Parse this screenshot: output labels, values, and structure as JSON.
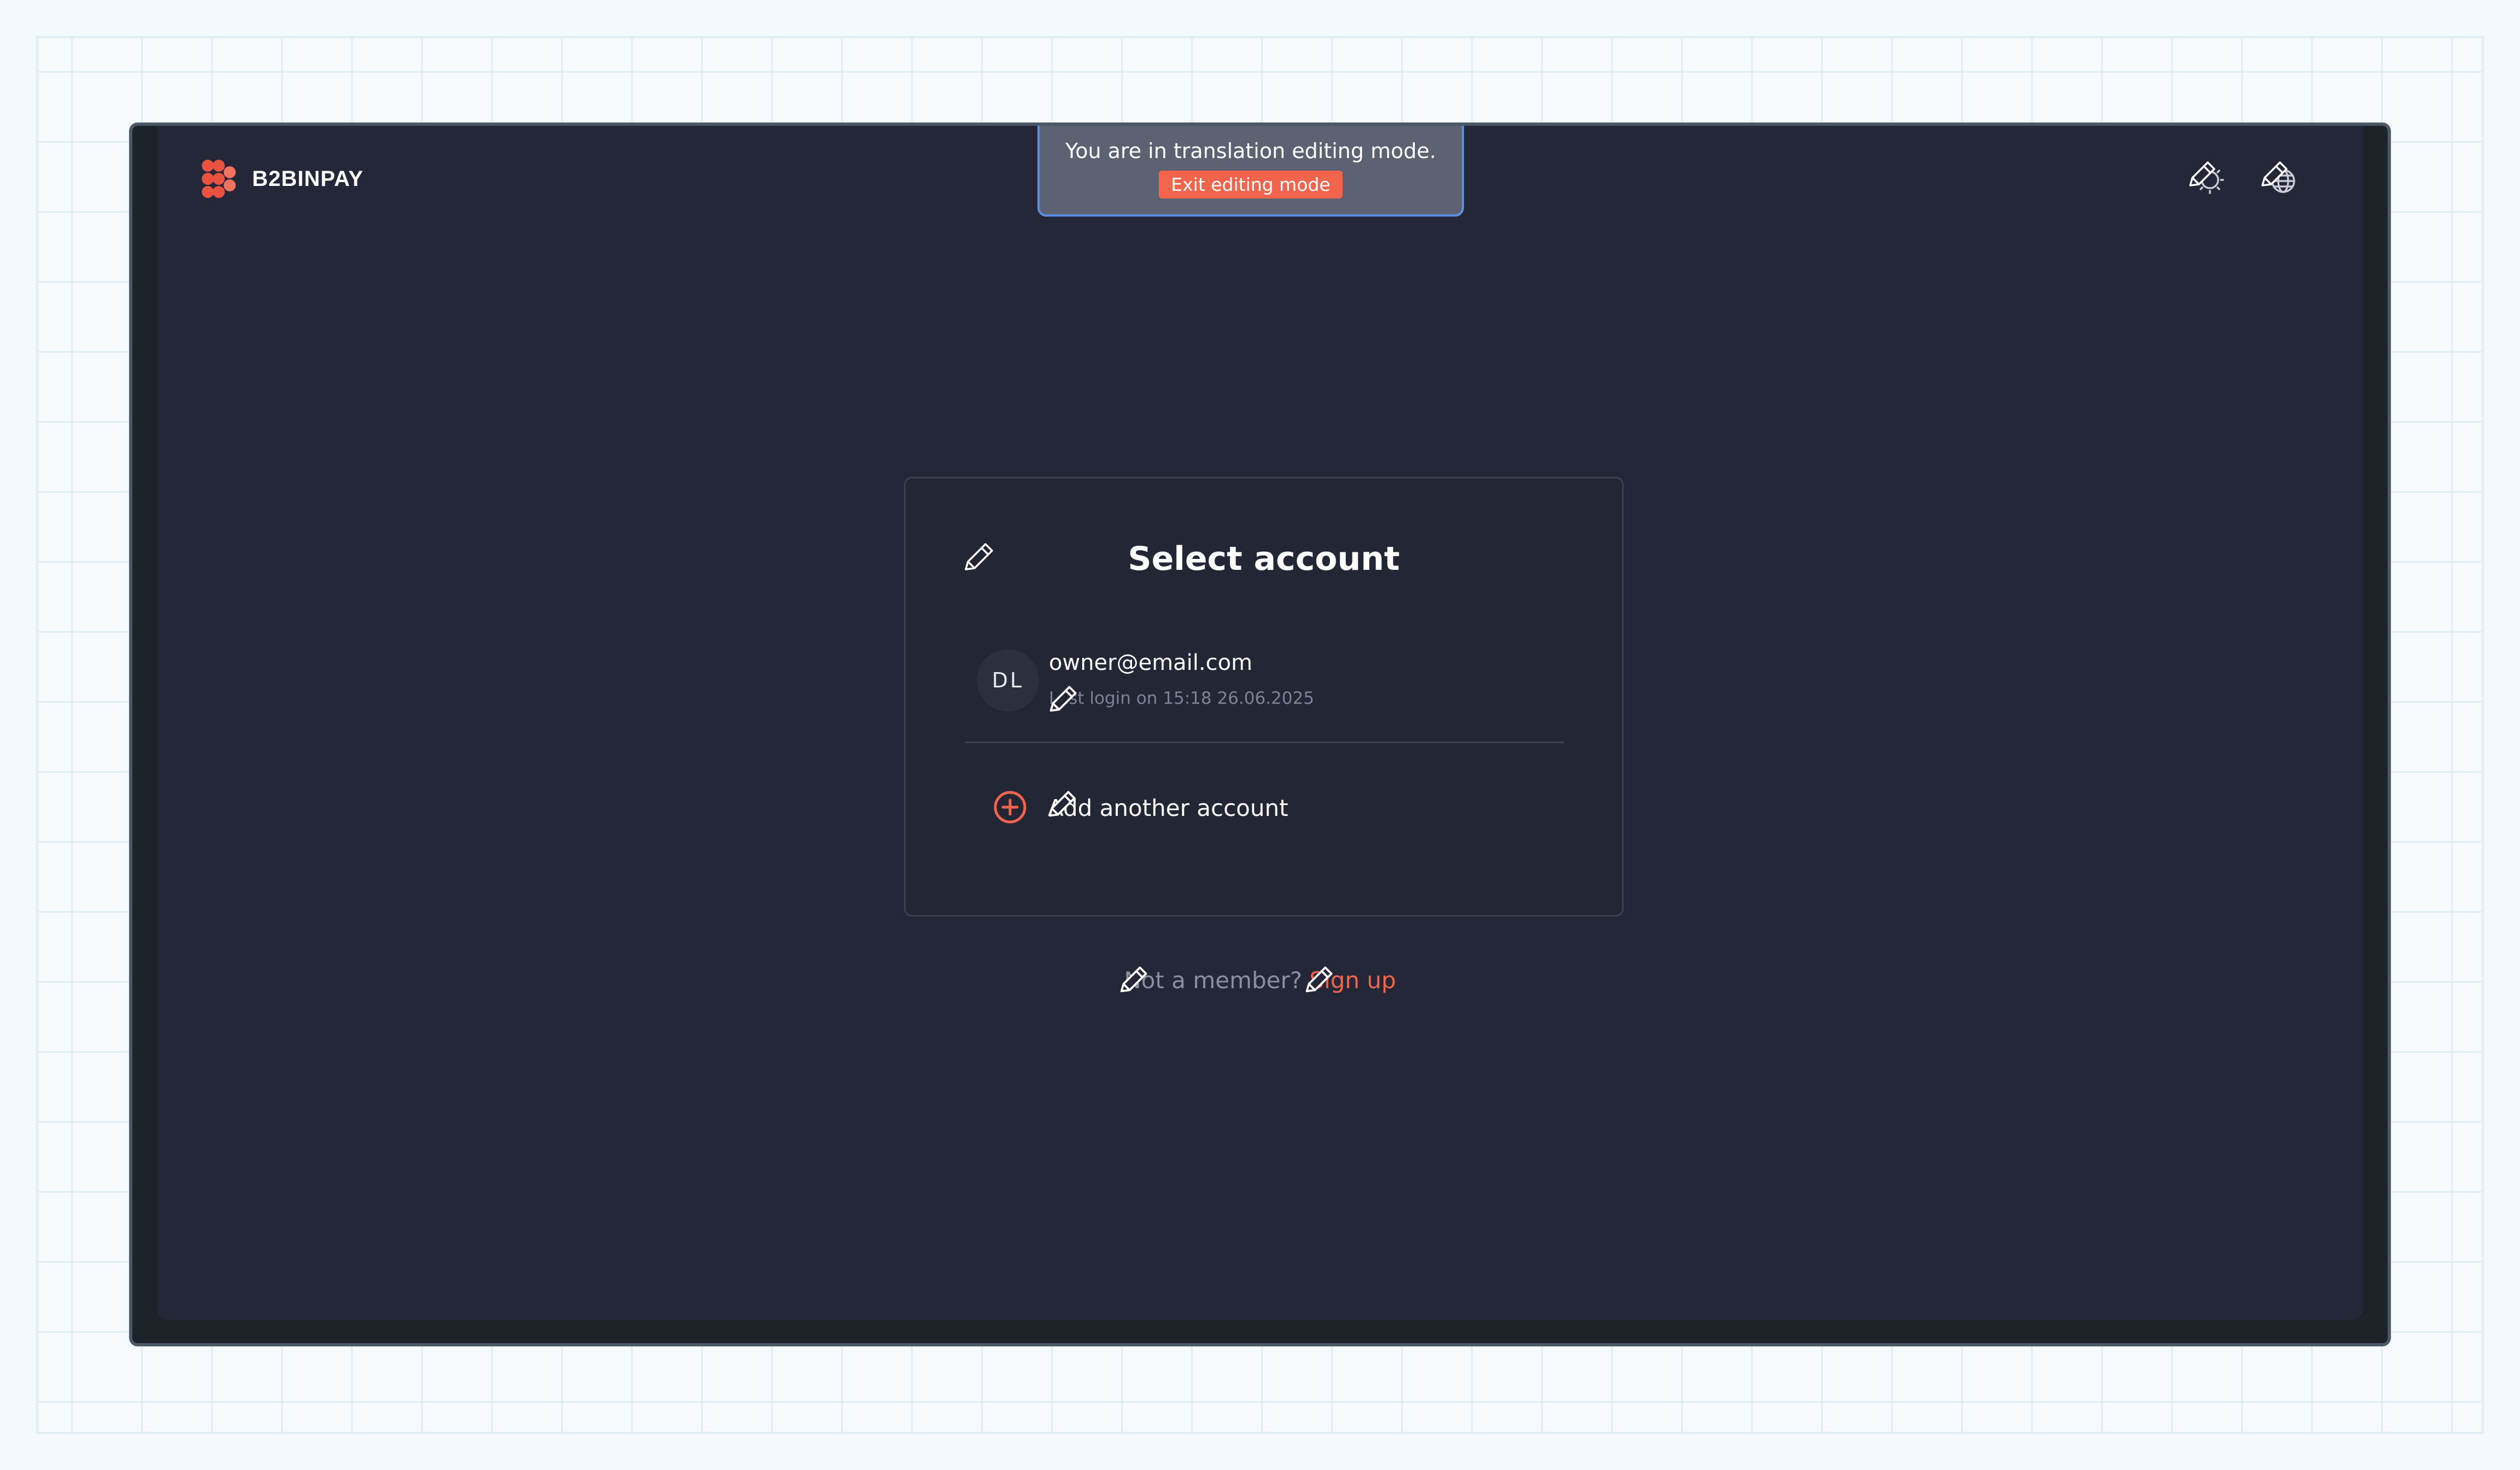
{
  "app": {
    "brand": "B2BINPAY",
    "colors": {
      "accent": "#f2644c",
      "background": "#232737",
      "banner_border": "#5b8fe6"
    }
  },
  "edit_banner": {
    "message": "You are in translation editing mode.",
    "exit_label": "Exit editing mode"
  },
  "header_icons": [
    "theme-toggle-icon",
    "language-globe-icon"
  ],
  "card": {
    "title": "Select account",
    "account": {
      "initials": "DL",
      "email": "owner@email.com",
      "last_login": "Last login on 15:18 26.06.2025"
    },
    "add_account_label": "Add another account"
  },
  "footer": {
    "not_member_text": "Not a member?",
    "signup_label": "Sign up"
  }
}
